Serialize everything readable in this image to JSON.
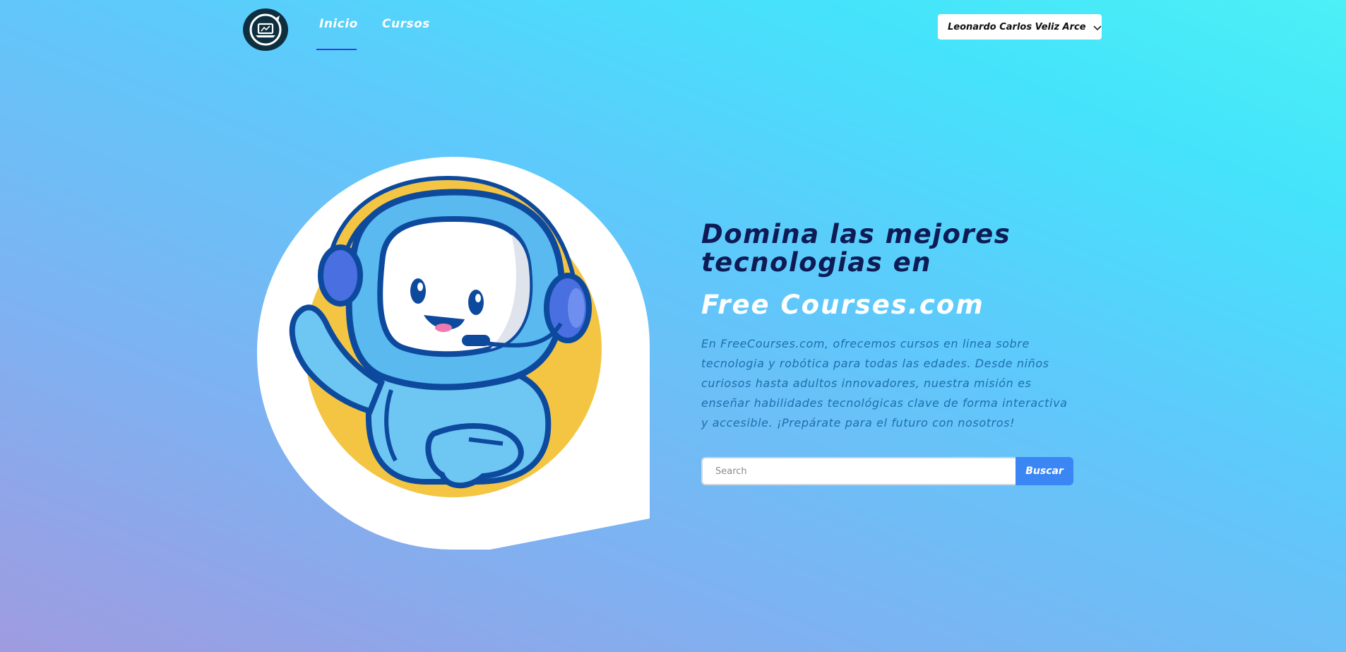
{
  "nav": {
    "logo_icon": "laptop-circle-logo-icon",
    "links": [
      {
        "label": "Inicio",
        "active": true
      },
      {
        "label": "Cursos",
        "active": false
      }
    ],
    "active_underline_color": "#3b3fd8"
  },
  "user_menu": {
    "name": "Leonardo Carlos Veliz Arce",
    "icon": "chevron-down-icon"
  },
  "hero": {
    "illustration": "robot-with-headset-waving-illustration",
    "title": "Domina las mejores tecnologias en",
    "brand": "Free Courses.com",
    "description": "En FreeCourses.com, ofrecemos cursos en linea sobre tecnologia y robótica para todas las edades. Desde niños curiosos hasta adultos innovadores, nuestra misión es enseñar habilidades tecnológicas clave de forma interactiva y accesible. ¡Prepárate para el futuro con nosotros!"
  },
  "search": {
    "placeholder": "Search",
    "value": "",
    "button_label": "Buscar"
  },
  "colors": {
    "title": "#0e1b55",
    "brand": "#ffffff",
    "description": "#1e6fae",
    "button": "#3a86f5",
    "logo_bg": "#0e2f3f"
  }
}
